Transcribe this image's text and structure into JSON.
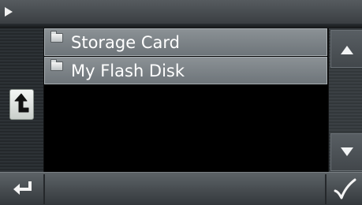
{
  "title_bar": {
    "play_icon": "play-icon"
  },
  "file_list": {
    "items": [
      {
        "label": "Storage Card",
        "icon": "folder-icon"
      },
      {
        "label": "My Flash Disk",
        "icon": "folder-icon"
      }
    ]
  },
  "left_panel": {
    "up_button_icon": "folder-up-icon"
  },
  "scrollbar": {
    "up_icon": "triangle-up-icon",
    "down_icon": "triangle-down-icon"
  },
  "bottom_bar": {
    "back_icon": "return-arrow-icon",
    "ok_icon": "checkmark-icon"
  },
  "colors": {
    "row_background": "#7c8388",
    "text": "#ffffff",
    "bar": "#4a4f53"
  }
}
